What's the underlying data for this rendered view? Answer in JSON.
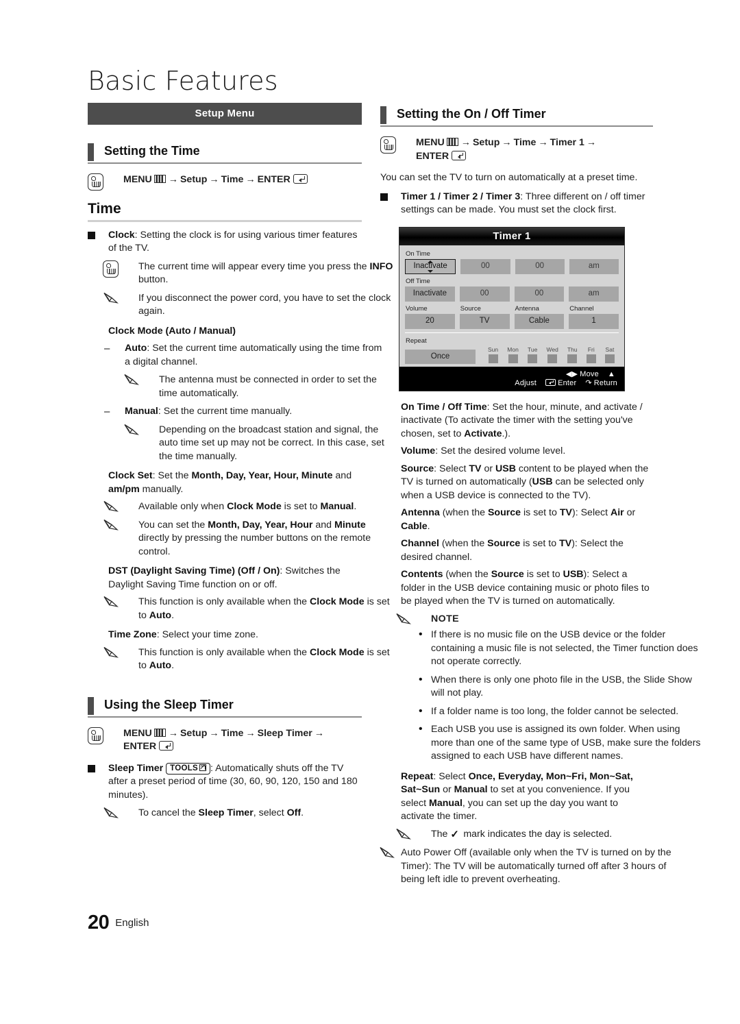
{
  "page": {
    "title": "Basic Features",
    "footer_number": "20",
    "footer_language": "English"
  },
  "left_column": {
    "banner": "Setup Menu",
    "section_heading": "Setting the Time",
    "menu_path": {
      "menu": "MENU",
      "steps": [
        "Setup",
        "Time"
      ],
      "enter": "ENTER"
    },
    "sub_heading": "Time",
    "clock_item": {
      "label": "Clock",
      "text": ": Setting the clock is for using various timer features of the TV."
    },
    "hand_note": {
      "pre": "The current time will appear every time you press the ",
      "bold": "INFO",
      "post": " button."
    },
    "pencil_note_1": "If you disconnect the power cord, you have to set the clock again.",
    "clock_mode_heading": "Clock Mode (Auto / Manual)",
    "auto_item": {
      "label": "Auto",
      "text": ": Set the current time automatically using the time from a digital channel."
    },
    "auto_note": "The antenna must be connected in order to set the time automatically.",
    "manual_item": {
      "label": "Manual",
      "text": ": Set the current time manually."
    },
    "manual_note": "Depending on the broadcast station and signal, the auto time set up may not be correct. In this case, set the time manually.",
    "clock_set": {
      "label": "Clock Set",
      "t1": ": Set the ",
      "b1": "Month, Day, Year, Hour, Minute",
      "t2": " and ",
      "b2": "am/pm",
      "t3": " manually."
    },
    "clock_set_note_1": {
      "t1": "Available only when ",
      "b1": "Clock Mode",
      "t2": " is set to ",
      "b2": "Manual",
      "t3": "."
    },
    "clock_set_note_2": {
      "t1": "You can set the ",
      "b1": "Month, Day, Year, Hour",
      "t2": " and ",
      "b2": "Minute",
      "t3": " directly by pressing the number buttons on the remote control."
    },
    "dst": {
      "label": "DST (Daylight Saving Time) (Off / On)",
      "text": ": Switches the Daylight Saving Time function on or off."
    },
    "dst_note": {
      "t1": "This function is only available when the ",
      "b1": "Clock Mode",
      "t2": " is set to ",
      "b2": "Auto",
      "t3": "."
    },
    "time_zone": {
      "label": "Time Zone",
      "text": ": Select your time zone."
    },
    "time_zone_note": {
      "t1": "This function is only available when the ",
      "b1": "Clock Mode",
      "t2": " is set to ",
      "b2": "Auto",
      "t3": "."
    },
    "sleep_heading": "Using the Sleep Timer",
    "sleep_menu_path": {
      "menu": "MENU",
      "steps": [
        "Setup",
        "Time",
        "Sleep Timer"
      ],
      "enter": "ENTER"
    },
    "sleep_item": {
      "label": "Sleep Timer",
      "tools": "TOOLS",
      "text": ": Automatically shuts off the TV after a preset period of time (30, 60, 90, 120, 150 and 180 minutes)."
    },
    "sleep_note": {
      "t1": "To cancel the ",
      "b1": "Sleep Timer",
      "t2": ", select ",
      "b2": "Off",
      "t3": "."
    }
  },
  "right_column": {
    "section_heading": "Setting the On / Off Timer",
    "menu_path": {
      "menu": "MENU",
      "steps": [
        "Setup",
        "Time",
        "Timer 1"
      ],
      "enter": "ENTER"
    },
    "intro": "You can set the TV to turn on automatically at a preset time.",
    "timer_item": {
      "label": "Timer 1 / Timer 2 / Timer 3",
      "text": ": Three different on / off timer settings can be made. You must set the clock first."
    },
    "osd": {
      "title": "Timer 1",
      "on_time_label": "On Time",
      "on_time": [
        "Inactivate",
        "00",
        "00",
        "am"
      ],
      "off_time_label": "Off Time",
      "off_time": [
        "Inactivate",
        "00",
        "00",
        "am"
      ],
      "field_labels": [
        "Volume",
        "Source",
        "Antenna",
        "Channel"
      ],
      "field_values": [
        "20",
        "TV",
        "Cable",
        "1"
      ],
      "repeat_label": "Repeat",
      "repeat_value": "Once",
      "days": [
        "Sun",
        "Mon",
        "Tue",
        "Wed",
        "Thu",
        "Fri",
        "Sat"
      ],
      "footer_keys": [
        "Move",
        "Adjust",
        "Enter",
        "Return"
      ]
    },
    "on_off_time": {
      "label": "On Time / Off Time",
      "t1": ": Set the hour, minute, and activate / inactivate (To activate the timer with the setting you've chosen, set to ",
      "b1": "Activate",
      "t2": ".)."
    },
    "volume": {
      "label": "Volume",
      "text": ": Set the desired volume level."
    },
    "source": {
      "label": "Source",
      "t1": ": Select ",
      "b1": "TV",
      "t2": " or ",
      "b2": "USB",
      "t3": " content to be played when the TV is turned on automatically (",
      "b3": "USB",
      "t4": " can be selected only when a USB device is connected to the TV)."
    },
    "antenna": {
      "label": "Antenna",
      "t1": " (when the ",
      "b1": "Source",
      "t2": " is set to ",
      "b2": "TV",
      "t3": "): Select ",
      "b3": "Air",
      "t4": " or ",
      "b4": "Cable",
      "t5": "."
    },
    "channel": {
      "label": "Channel",
      "t1": " (when the ",
      "b1": "Source",
      "t2": " is set to ",
      "b2": "TV",
      "t3": "): Select the desired channel."
    },
    "contents": {
      "label": "Contents",
      "t1": " (when the ",
      "b1": "Source",
      "t2": " is set to ",
      "b2": "USB",
      "t3": "): Select a folder in the USB device containing music or photo files to be played when the TV is turned on automatically."
    },
    "note_label": "NOTE",
    "notes": [
      "If there is no music file on the USB device or the folder containing a music file is not selected, the Timer function does not operate correctly.",
      "When there is only one photo file in the USB, the Slide Show will not play.",
      "If a folder name is too long, the folder cannot be selected.",
      "Each USB you use is assigned its own folder. When using more than one of the same type of USB, make sure the folders assigned to each USB have different names."
    ],
    "repeat": {
      "label": "Repeat",
      "t1": ": Select ",
      "b1": "Once, Everyday, Mon~Fri, Mon~Sat, Sat~Sun",
      "t2": " or ",
      "b2": "Manual",
      "t3": " to set at you convenience. If you select ",
      "b3": "Manual",
      "t4": ", you can set up the day you want to activate the timer."
    },
    "repeat_note": {
      "t1": "The ",
      "t2": " mark indicates the day is selected."
    },
    "auto_power_off": "Auto Power Off (available only when the TV is turned on by the Timer): The TV will be automatically turned off after 3 hours of being left idle to prevent overheating."
  },
  "colors": {
    "banner_bg": "#4d4d4d",
    "heading_bar": "#4d4d4d",
    "osd_bg": "#d4d4d4",
    "osd_cell": "#a6a6a6",
    "osd_title_bg": "#000000"
  }
}
